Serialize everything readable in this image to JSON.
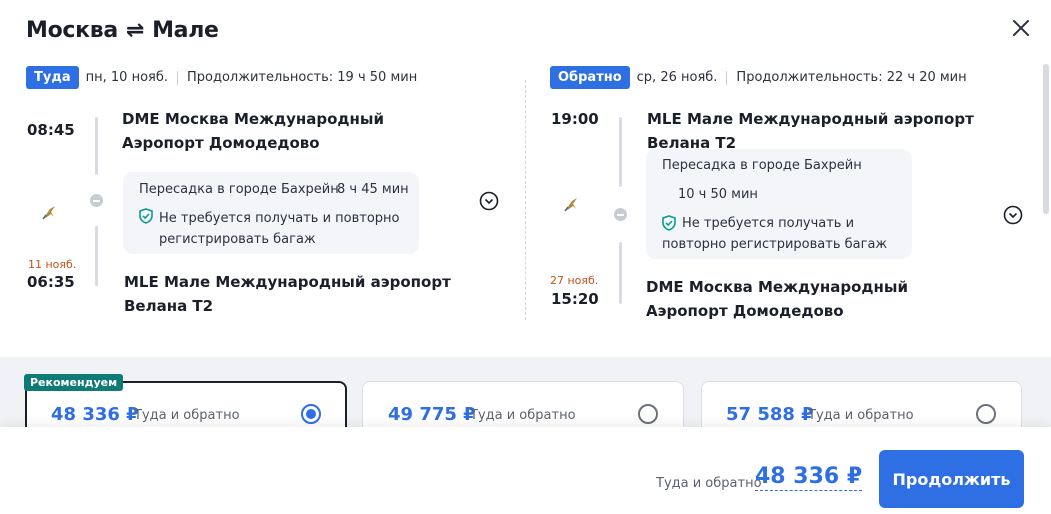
{
  "header": {
    "from": "Москва",
    "to": "Мале",
    "swap_symbol": "⇌"
  },
  "outbound": {
    "badge": "Туда",
    "date": "пн, 10 нояб.",
    "duration": "Продолжительность: 19 ч 50 мин",
    "depart_time": "08:45",
    "depart_airport": "DME Москва Международный Аэропорт Домодедово",
    "transfer_city": "Пересадка в городе Бахрейн",
    "transfer_time": "8 ч 45 мин",
    "baggage_note": "Не требуется получать и повторно регистрировать багаж",
    "arrive_date": "11 нояб.",
    "arrive_time": "06:35",
    "arrive_airport": "MLE Мале Международный аэропорт Велана T2"
  },
  "return": {
    "badge": "Обратно",
    "date": "ср, 26 нояб.",
    "duration": "Продолжительность: 22 ч 20 мин",
    "depart_time": "19:00",
    "depart_airport": "MLE Мале Международный аэропорт Велана T2",
    "transfer_city": "Пересадка в городе Бахрейн",
    "transfer_time": "10 ч 50 мин",
    "baggage_note": "Не требуется получать и повторно регистрировать багаж",
    "arrive_date": "27 нояб.",
    "arrive_time": "15:20",
    "arrive_airport": "DME Москва Международный Аэропорт Домодедово"
  },
  "fare_options": [
    {
      "tag": "Рекомендуем",
      "price": "48 336 ₽",
      "label": "Туда и обратно",
      "selected": true
    },
    {
      "price": "49 775 ₽",
      "label": "Туда и обратно",
      "selected": false
    },
    {
      "price": "57 588 ₽",
      "label": "Туда и обратно",
      "selected": false
    }
  ],
  "footer": {
    "total_label": "Туда и обратно",
    "total_price": "48 336 ₽",
    "continue_label": "Продолжить"
  },
  "colors": {
    "accent": "#2f6fe4",
    "recommended": "#0f7b77",
    "date_change": "#c0531e"
  }
}
